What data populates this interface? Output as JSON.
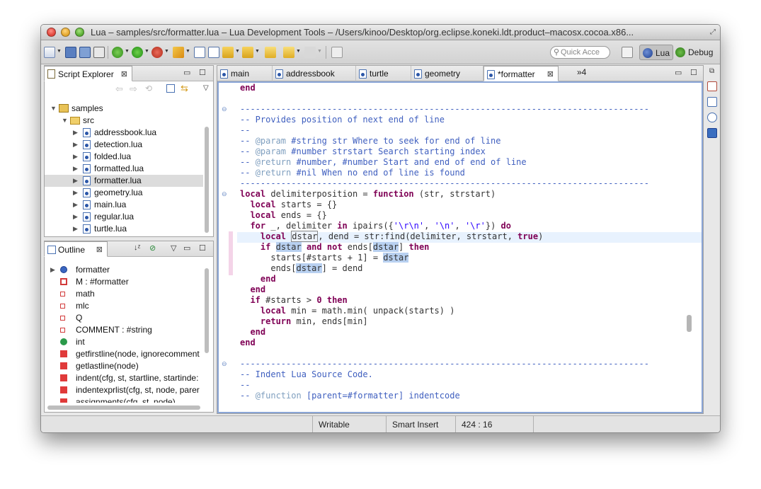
{
  "window": {
    "title": "Lua – samples/src/formatter.lua – Lua Development Tools – /Users/kinoo/Desktop/org.eclipse.koneki.ldt.product–macosx.cocoa.x86..."
  },
  "toolbar": {
    "quick_access_placeholder": "Quick Acce",
    "perspective_lua": "Lua",
    "perspective_debug": "Debug"
  },
  "script_explorer": {
    "title": "Script Explorer",
    "close": "⊠",
    "project": "samples",
    "folder": "src",
    "files": [
      "addressbook.lua",
      "detection.lua",
      "folded.lua",
      "formatted.lua",
      "formatter.lua",
      "geometry.lua",
      "main.lua",
      "regular.lua",
      "turtle.lua"
    ],
    "selected_index": 4
  },
  "outline": {
    "title": "Outline",
    "close": "⊠",
    "items": [
      "formatter",
      "M : #formatter",
      "math",
      "mlc",
      "Q",
      "COMMENT : #string",
      "int",
      "getfirstline(node, ignorecomment",
      "getlastline(node)",
      "indent(cfg, st, startline, startinde:",
      "indentexprlist(cfg, st, node, parer",
      "assignments(cfg, st, node)"
    ]
  },
  "editor": {
    "tabs": [
      "main",
      "addressbook",
      "turtle",
      "geometry",
      "*formatter"
    ],
    "active_tab_index": 4,
    "overflow_count": "»4",
    "close": "⊠"
  },
  "status": {
    "writable": "Writable",
    "insert_mode": "Smart Insert",
    "position": "424 : 16"
  },
  "colors": {
    "keyword": "#7f0055",
    "comment": "#3f5fbf",
    "string": "#2a00ff",
    "highlight": "#b8d0f0",
    "editor_border": "#8aa5d6"
  }
}
